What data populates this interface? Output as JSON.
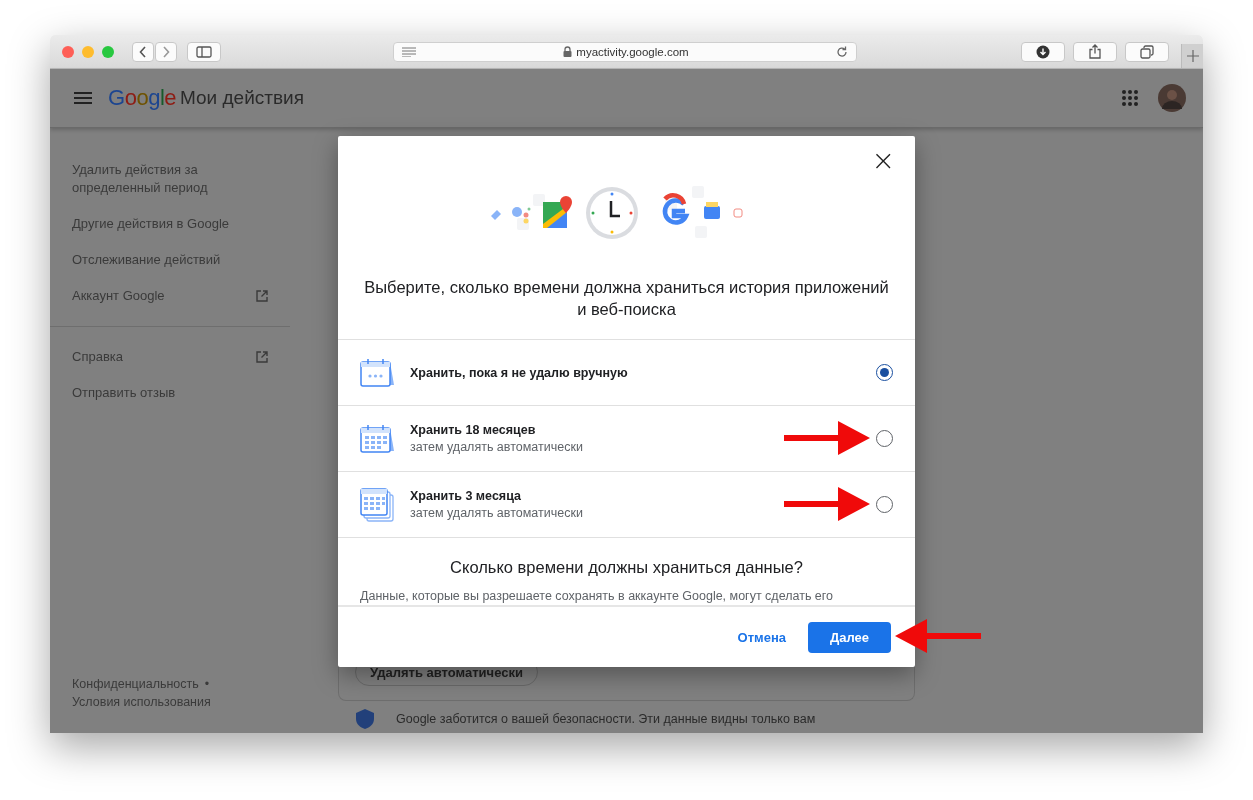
{
  "browser": {
    "url": "myactivity.google.com"
  },
  "app_bar": {
    "logo": "Google",
    "title": "Мои действия"
  },
  "sidebar": {
    "sections": [
      [
        {
          "label": "Удалить действия за определенный период",
          "external": false
        },
        {
          "label": "Другие действия в Google",
          "external": false
        },
        {
          "label": "Отслеживание действий",
          "external": false
        },
        {
          "label": "Аккаунт Google",
          "external": true
        }
      ],
      [
        {
          "label": "Справка",
          "external": true
        },
        {
          "label": "Отправить отзыв",
          "external": false
        }
      ]
    ],
    "footer_links": [
      "Конфиденциальность",
      "Условия использования"
    ],
    "footer_separator": "•"
  },
  "background": {
    "button": "Удалять автоматически",
    "notice": "Google заботится о вашей безопасности. Эти данные видны только вам"
  },
  "dialog": {
    "close": "×",
    "title": "Выберите, сколько времени должна храниться история приложений и веб-поиска",
    "options": [
      {
        "title": "Хранить, пока я не удалю вручную",
        "selected": true,
        "arrow": false
      },
      {
        "title": "Хранить 18 месяцев",
        "subtitle": "затем удалять автоматически",
        "selected": false,
        "arrow": true
      },
      {
        "title": "Хранить 3 месяца",
        "subtitle": "затем удалять автоматически",
        "selected": false,
        "arrow": true
      }
    ],
    "section_title": "Сколько времени должны храниться данные?",
    "section_text": "Данные, которые вы разрешаете сохранять в аккаунте Google, могут сделать его",
    "cancel": "Отмена",
    "next": {
      "label": "Далее",
      "arrow": true
    }
  }
}
